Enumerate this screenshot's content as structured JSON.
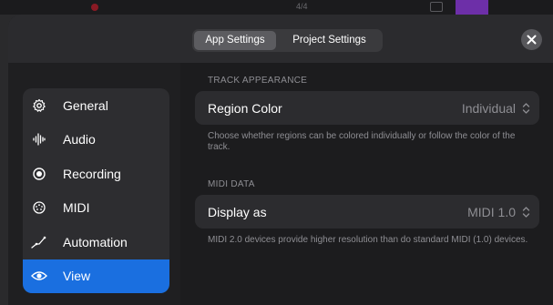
{
  "background_app": {
    "counter_text": "4/4"
  },
  "header": {
    "tabs": [
      {
        "label": "App Settings",
        "active": true
      },
      {
        "label": "Project Settings",
        "active": false
      }
    ],
    "close_icon": "close-icon"
  },
  "sidebar": {
    "items": [
      {
        "label": "General",
        "icon": "gear-icon",
        "active": false
      },
      {
        "label": "Audio",
        "icon": "waveform-icon",
        "active": false
      },
      {
        "label": "Recording",
        "icon": "record-icon",
        "active": false
      },
      {
        "label": "MIDI",
        "icon": "midi-port-icon",
        "active": false
      },
      {
        "label": "Automation",
        "icon": "automation-icon",
        "active": false
      },
      {
        "label": "View",
        "icon": "eye-icon",
        "active": true
      }
    ]
  },
  "main": {
    "track_appearance": {
      "title": "TRACK APPEARANCE",
      "region_color_label": "Region Color",
      "region_color_value": "Individual",
      "description": "Choose whether regions can be colored individually or follow the color of the track."
    },
    "midi_data": {
      "title": "MIDI DATA",
      "display_as_label": "Display as",
      "display_as_value": "MIDI 1.0",
      "description": "MIDI 2.0 devices provide higher resolution than do standard MIDI (1.0) devices."
    }
  },
  "colors": {
    "accent": "#1a6fe0",
    "modal_bg": "#232325",
    "row_bg": "#2c2c2f"
  }
}
